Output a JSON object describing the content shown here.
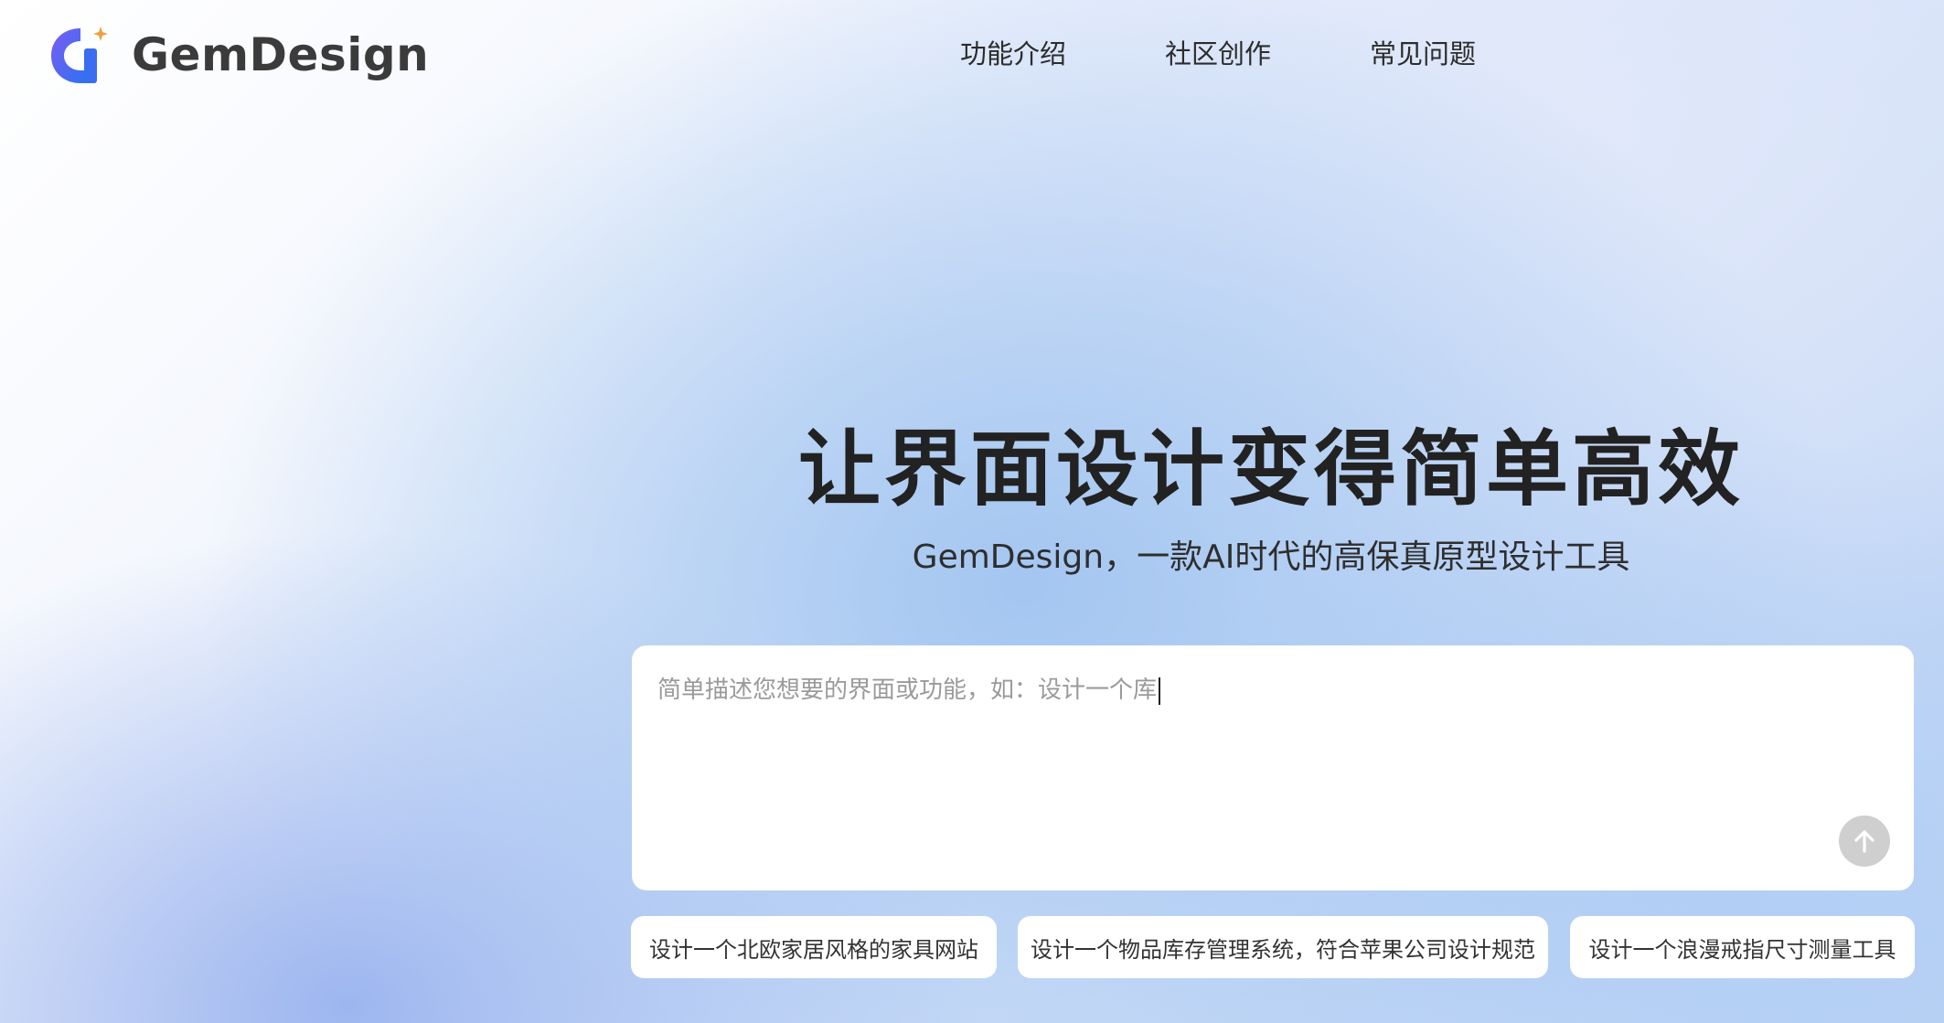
{
  "brand": {
    "name": "GemDesign",
    "colors": {
      "logo_gradient_start": "#6a5cf0",
      "logo_gradient_end": "#2f73f0",
      "logo_spark": "#f0a040"
    }
  },
  "nav": {
    "items": [
      {
        "label": "功能介绍"
      },
      {
        "label": "社区创作"
      },
      {
        "label": "常见问题"
      }
    ]
  },
  "hero": {
    "title": "让界面设计变得简单高效",
    "subtitle": "GemDesign，一款AI时代的高保真原型设计工具"
  },
  "prompt": {
    "value": "简单描述您想要的界面或功能，如：设计一个库",
    "send_icon": "arrow-up-icon"
  },
  "suggestions": [
    {
      "label": "设计一个北欧家居风格的家具网站"
    },
    {
      "label": "设计一个物品库存管理系统，符合苹果公司设计规范"
    },
    {
      "label": "设计一个浪漫戒指尺寸测量工具"
    }
  ]
}
